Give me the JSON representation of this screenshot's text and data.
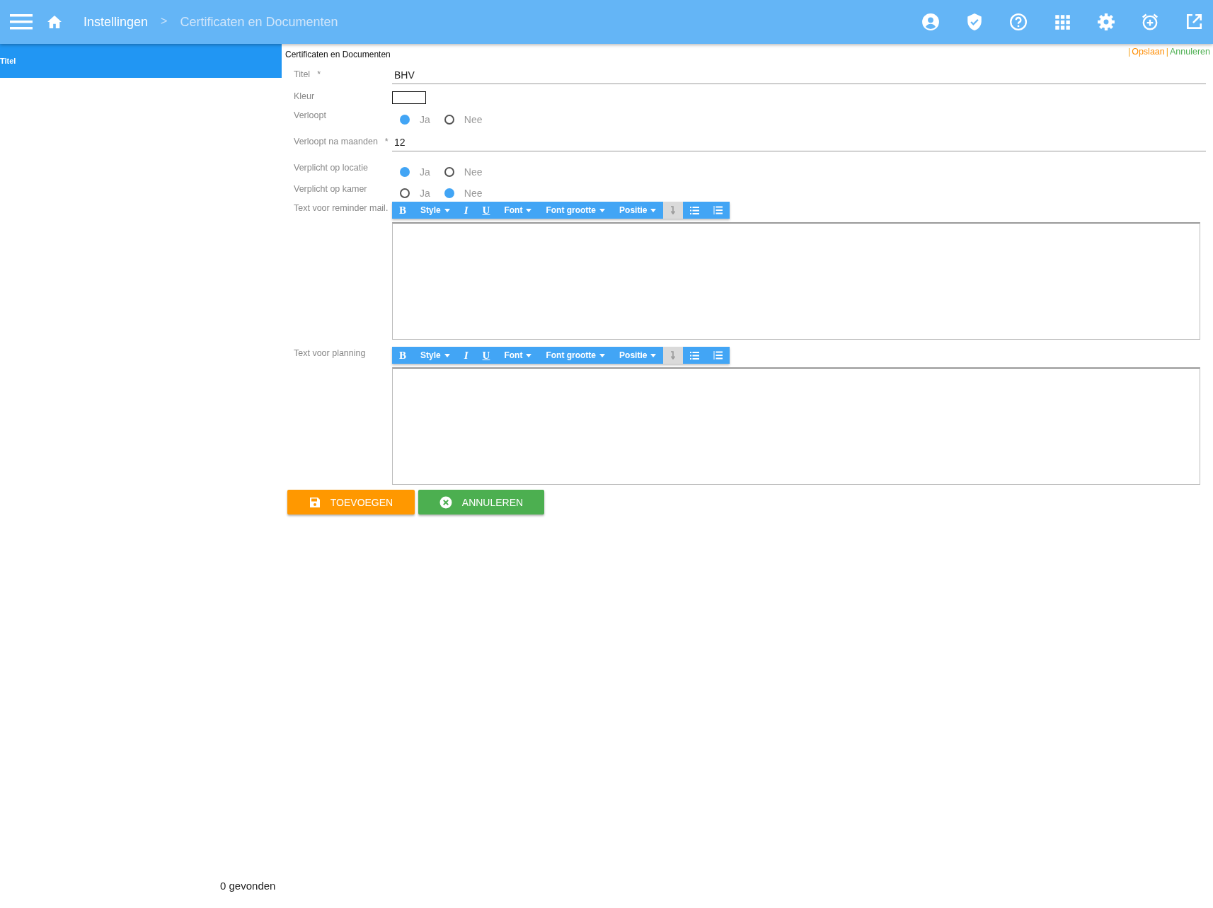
{
  "header": {
    "breadcrumb": [
      {
        "label": "Instellingen",
        "selected": false
      },
      {
        "label": "Certificaten en Documenten",
        "selected": true
      }
    ],
    "separator": ">"
  },
  "sidebar": {
    "items": [
      {
        "label": "Titel",
        "selected": true
      }
    ]
  },
  "form": {
    "title": "Certificaten en Documenten",
    "actions": [
      {
        "label": "Opslaan",
        "color": "#ff8c00"
      },
      {
        "label": "Annuleren",
        "color": "#4caf50"
      }
    ],
    "separator": "|",
    "fields": [
      {
        "kind": "text",
        "label": "Titel",
        "required_mark": "*",
        "value": "BHV"
      },
      {
        "kind": "color",
        "label": "Kleur",
        "color": "#ffffff"
      },
      {
        "kind": "radio",
        "label": "Verloopt",
        "options": [
          {
            "label": "Ja",
            "selected": true
          },
          {
            "label": "Nee",
            "selected": false
          }
        ]
      },
      {
        "kind": "text",
        "label": "Verloopt na maanden",
        "required_mark": "*",
        "value": "12"
      },
      {
        "kind": "radio",
        "label": "Verplicht op locatie",
        "options": [
          {
            "label": "Ja",
            "selected": true
          },
          {
            "label": "Nee",
            "selected": false
          }
        ]
      },
      {
        "kind": "radio",
        "label": "Verplicht op kamer",
        "options": [
          {
            "label": "Ja",
            "selected": false
          },
          {
            "label": "Nee",
            "selected": true
          }
        ]
      },
      {
        "kind": "editor",
        "label": "Text voor reminder mail.",
        "toolbar": [
          {
            "kind": "bold",
            "label": "B",
            "disabled": false
          },
          {
            "kind": "dropdown",
            "label": "Style",
            "disabled": false
          },
          {
            "kind": "italic",
            "label": "I",
            "disabled": false
          },
          {
            "kind": "underline",
            "label": "U",
            "disabled": false
          },
          {
            "kind": "dropdown",
            "label": "Font",
            "disabled": false
          },
          {
            "kind": "dropdown",
            "label": "Font grootte",
            "disabled": false
          },
          {
            "kind": "dropdown",
            "label": "Positie",
            "disabled": false
          },
          {
            "kind": "arrow",
            "disabled": true
          },
          {
            "kind": "bullets",
            "disabled": false
          },
          {
            "kind": "numbers",
            "disabled": false
          }
        ]
      },
      {
        "kind": "editor",
        "label": "Text voor planning",
        "toolbar": [
          {
            "kind": "bold",
            "label": "B",
            "disabled": false
          },
          {
            "kind": "dropdown",
            "label": "Style",
            "disabled": false
          },
          {
            "kind": "italic",
            "label": "I",
            "disabled": false
          },
          {
            "kind": "underline",
            "label": "U",
            "disabled": false
          },
          {
            "kind": "dropdown",
            "label": "Font",
            "disabled": false
          },
          {
            "kind": "dropdown",
            "label": "Font grootte",
            "disabled": false
          },
          {
            "kind": "dropdown",
            "label": "Positie",
            "disabled": false
          },
          {
            "kind": "arrow",
            "disabled": true
          },
          {
            "kind": "bullets",
            "disabled": false
          },
          {
            "kind": "numbers",
            "disabled": false
          }
        ]
      }
    ],
    "buttons": [
      {
        "kind": "save",
        "label": "TOEVOEGEN",
        "color": "#ff9800"
      },
      {
        "kind": "cancel",
        "label": "ANNULEREN",
        "color": "#4caf50"
      }
    ]
  },
  "footer": {
    "count": "0 gevonden"
  }
}
